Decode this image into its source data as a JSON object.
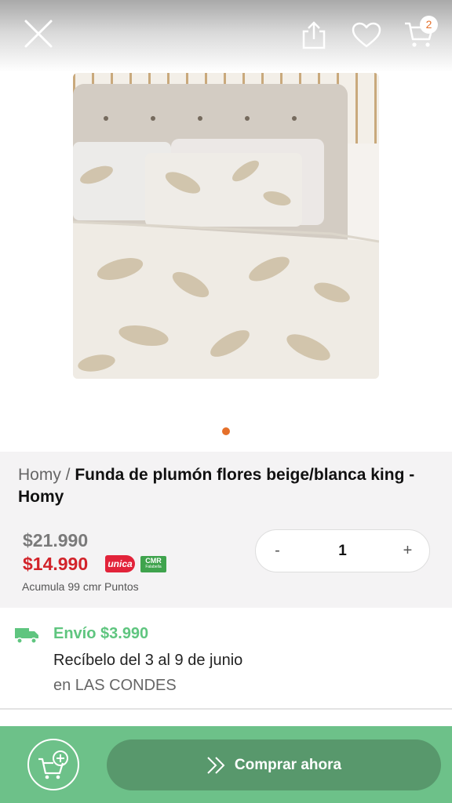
{
  "header": {
    "close_icon": "close-icon",
    "share_icon": "share-icon",
    "favorite_icon": "heart-icon",
    "cart_icon": "cart-icon",
    "cart_count": "2"
  },
  "gallery": {
    "image_subject": "bed with beige/white floral duvet cover",
    "pages": 1,
    "active_page": 1,
    "accent_color": "#e5702a"
  },
  "product": {
    "brand": "Homy /",
    "name": "Funda de plumón flores beige/blanca king - Homy",
    "old_price": "$21.990",
    "price": "$14.990",
    "unica_badge": "unica",
    "cmr_badge": "CMR",
    "cmr_badge_sub": "Falabella",
    "points": "Acumula 99 cmr Puntos"
  },
  "quantity": {
    "minus": "-",
    "value": "1",
    "plus": "+"
  },
  "shipping": {
    "icon": "truck-icon",
    "title": "Envío $3.990",
    "dates": "Recíbelo del 3 al 9 de junio",
    "place": "en LAS CONDES"
  },
  "footer": {
    "add_to_cart_icon": "add-to-cart-icon",
    "buy_label": "Comprar ahora",
    "bar_color": "#6dc189",
    "button_color": "#58986c"
  }
}
